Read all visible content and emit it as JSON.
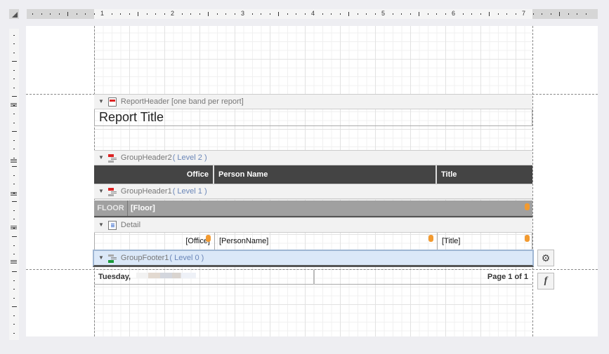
{
  "ruler": {
    "numbers": [
      "1",
      "2",
      "3",
      "4",
      "5",
      "6",
      "7"
    ]
  },
  "bands": {
    "report_header": {
      "caption": "ReportHeader",
      "note": "[one band per report]",
      "title": "Report Title"
    },
    "group_header2": {
      "caption": "GroupHeader2",
      "level": "( Level 2 )",
      "columns": [
        "Office",
        "Person Name",
        "Title"
      ]
    },
    "group_header1": {
      "caption": "GroupHeader1",
      "level": "( Level 1 )",
      "label": "FLOOR",
      "field": "[Floor]"
    },
    "detail": {
      "caption": "Detail",
      "fields": [
        "[Office]",
        "[PersonName]",
        "[Title]"
      ]
    },
    "group_footer1": {
      "caption": "GroupFooter1",
      "level": "( Level 0 )"
    },
    "bottom_margin": {
      "date": "Tuesday,",
      "page": "Page 1 of 1"
    }
  },
  "side_buttons": [
    {
      "icon": "gear-icon",
      "label": ""
    },
    {
      "icon": "function-icon",
      "label": "f"
    }
  ],
  "colors": {
    "header_dark": "#444444",
    "group_gray": "#a0a0a0",
    "selected": "#dbe8f8",
    "accent_db": "#f29a30"
  }
}
